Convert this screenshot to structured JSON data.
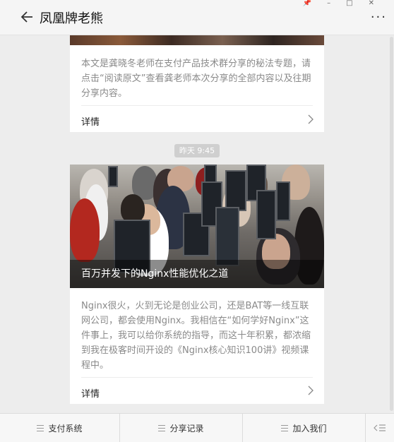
{
  "header": {
    "title": "凤凰牌老熊",
    "more": "···"
  },
  "window_controls": [
    "📌",
    "–",
    "□",
    "✕"
  ],
  "cards": [
    {
      "description": "本文是龚晓冬老师在支付产品技术群分享的秘法专题，请点击“阅读原文”查看龚老师本次分享的全部内容以及往期分享内容。",
      "detail_label": "详情"
    },
    {
      "caption": "百万并发下的Nginx性能优化之道",
      "description": "Nginx很火，火到无论是创业公司，还是BAT等一线互联网公司，都会使用Nginx。我相信在“如何学好Nginx”这件事上，我可以给你系统的指导，而这十年积累，都浓缩到我在极客时间开设的《Nginx核心知识100讲》视频课程中。",
      "detail_label": "详情"
    }
  ],
  "timestamp": "昨天 9:45",
  "bottom_nav": {
    "items": [
      {
        "label": "支付系统"
      },
      {
        "label": "分享记录"
      },
      {
        "label": "加入我们"
      }
    ]
  },
  "icons": {
    "back": "back-arrow-icon",
    "chevron": "chevron-right-icon",
    "menu": "menu-icon",
    "keyboard": "keyboard-switch-icon"
  }
}
